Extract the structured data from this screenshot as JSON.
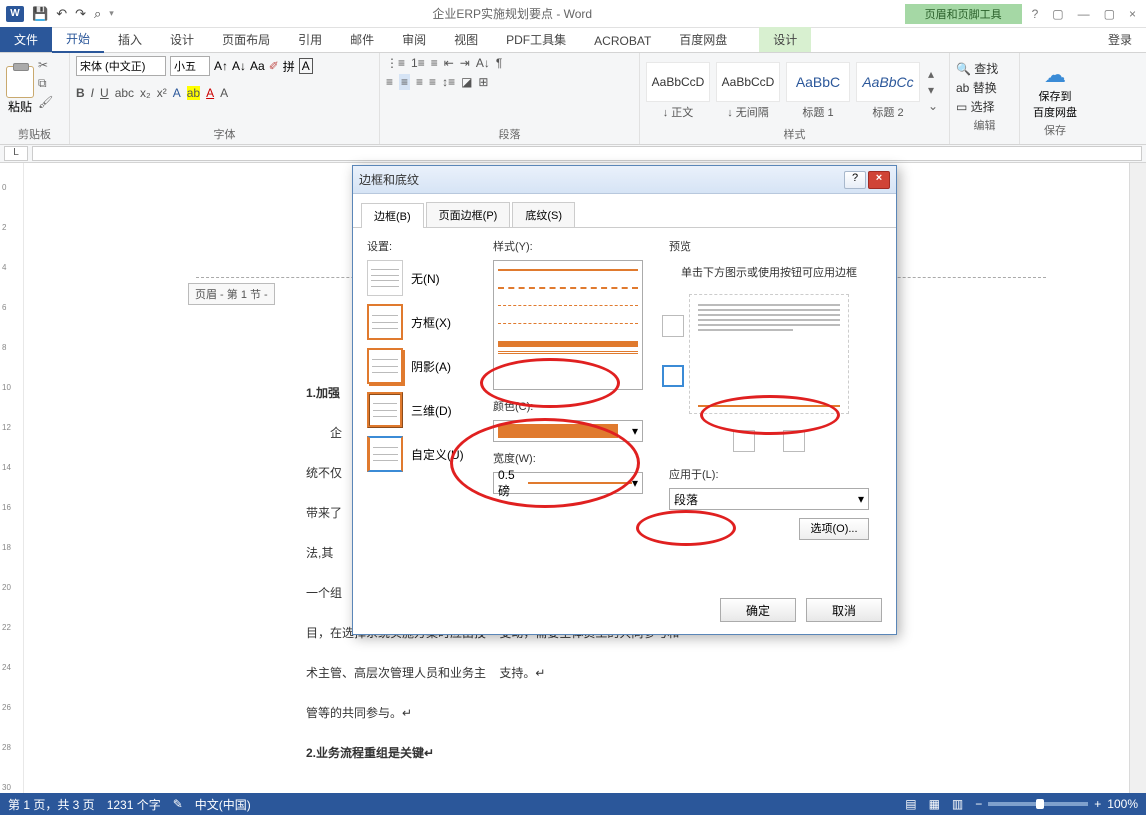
{
  "titlebar": {
    "title": "企业ERP实施规划要点 - Word",
    "context_tool": "页眉和页脚工具"
  },
  "qat_icons": [
    "save-icon",
    "undo-icon",
    "redo-icon",
    "print-icon"
  ],
  "winbtns": {
    "help": "?",
    "opts": "▢",
    "min": "—",
    "max": "▢",
    "close": "×"
  },
  "tabs": {
    "file": "文件",
    "home": "开始",
    "insert": "插入",
    "design": "设计",
    "layout": "页面布局",
    "ref": "引用",
    "mail": "邮件",
    "review": "审阅",
    "view": "视图",
    "pdf": "PDF工具集",
    "acrobat": "ACROBAT",
    "baidu": "百度网盘",
    "context": "设计",
    "login": "登录"
  },
  "ribbon": {
    "clipboard": "剪贴板",
    "paste": "粘贴",
    "font": "字体",
    "para": "段落",
    "styles": "样式",
    "edit": "编辑",
    "save": "保存",
    "font_name": "宋体 (中文正)",
    "font_size": "小五",
    "style_items": [
      {
        "prev": "AaBbCcD",
        "cap": "↓ 正文"
      },
      {
        "prev": "AaBbCcD",
        "cap": "↓ 无间隔"
      },
      {
        "prev": "AaBbC",
        "cap": "标题 1"
      },
      {
        "prev": "AaBbCc",
        "cap": "标题 2"
      }
    ],
    "find": "查找",
    "replace": "替换",
    "select": "选择",
    "saveto": "保存到",
    "baiduy": "百度网盘"
  },
  "ruler_label": "L",
  "header_tag": "页眉 - 第 1 节 -",
  "doc": {
    "h1": "1.加强",
    "l1": "企",
    "l2": "统不仅",
    "l3": "带来了",
    "l4": "法,其",
    "l5": "一个组",
    "l6a": "目，在选择系统实施方案时应由技",
    "l6b": "变动，需要全体员工的共同参与和",
    "l7a": "术主管、高层次管理人员和业务主",
    "l7b": "支持。↵",
    "l8": "管等的共同参与。↵",
    "h2": "2.业务流程重组是关键↵"
  },
  "status": {
    "page": "第 1 页，共 3 页",
    "words": "1231 个字",
    "lang": "中文(中国)",
    "zoom": "100%"
  },
  "dialog": {
    "title": "边框和底纹",
    "tabs": {
      "border": "边框(B)",
      "page": "页面边框(P)",
      "shade": "底纹(S)"
    },
    "setting": "设置:",
    "presets": {
      "none": "无(N)",
      "box": "方框(X)",
      "shadow": "阴影(A)",
      "d3": "三维(D)",
      "custom": "自定义(U)"
    },
    "style": "样式(Y):",
    "color": "颜色(C):",
    "width": "宽度(W):",
    "width_val": "0.5 磅",
    "preview": "预览",
    "preview_hint": "单击下方图示或使用按钮可应用边框",
    "applyto": "应用于(L):",
    "apply_val": "段落",
    "options": "选项(O)...",
    "ok": "确定",
    "cancel": "取消"
  }
}
